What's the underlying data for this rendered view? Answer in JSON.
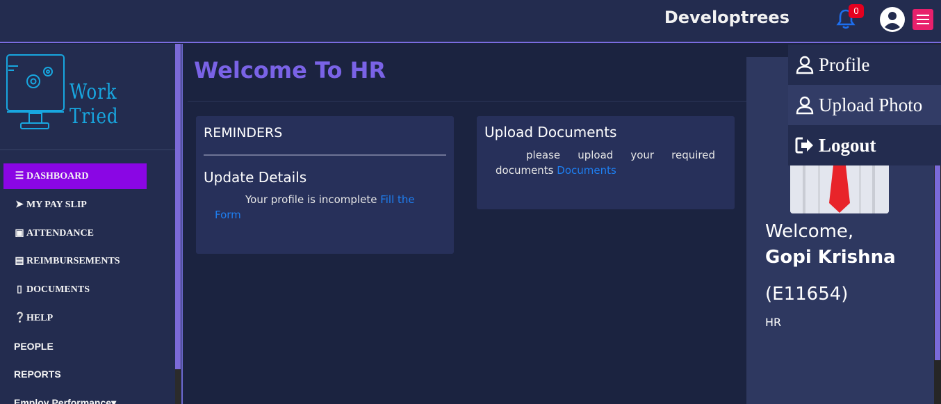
{
  "topbar": {
    "brand": "Developtrees",
    "notification_count": "0"
  },
  "sidebar": {
    "logo_text": "Work Tried",
    "items": [
      {
        "label": "DASHBOARD",
        "icon": "bars-icon",
        "active": true
      },
      {
        "label": "MY PAY SLIP",
        "icon": "paper-plane-icon"
      },
      {
        "label": "ATTENDANCE",
        "icon": "calendar-icon"
      },
      {
        "label": "REIMBURSEMENTS",
        "icon": "credit-card-icon"
      },
      {
        "label": "DOCUMENTS",
        "icon": "file-icon"
      },
      {
        "label": "HELP",
        "icon": "question-circle-icon"
      },
      {
        "label": "PEOPLE"
      },
      {
        "label": "REPORTS"
      },
      {
        "label": "Employ Performance",
        "icon": "caret-down-icon"
      }
    ]
  },
  "main": {
    "title": "Welcome To HR",
    "reminders": {
      "heading": "REMINDERS",
      "subheading": "Update Details",
      "text": "Your profile is incomplete",
      "link": "Fill the Form"
    },
    "upload": {
      "heading": "Upload Documents",
      "text": "please upload your required documents",
      "link": "Documents"
    }
  },
  "profile": {
    "welcome": "Welcome,",
    "name": "Gopi Krishna",
    "employee_id": "(E11654)",
    "role": "HR"
  },
  "dropdown": {
    "items": [
      {
        "label": "Profile",
        "icon": "user-icon"
      },
      {
        "label": "Upload Photo",
        "icon": "user-icon"
      },
      {
        "label": "Logout",
        "icon": "sign-out-icon"
      }
    ]
  },
  "colors": {
    "accent": "#7a63e6",
    "active_nav": "#8a06e4",
    "link": "#1e7ef0",
    "badge": "#e4001f",
    "menu_button": "#e8206c"
  }
}
